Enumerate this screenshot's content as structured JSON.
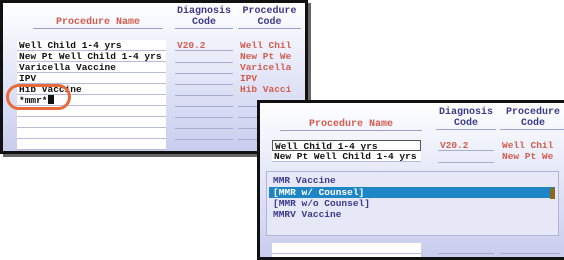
{
  "left_panel": {
    "headers": {
      "procedure_name": "Procedure Name",
      "diagnosis_code": [
        "Diagnosis",
        "Code"
      ],
      "procedure_code": [
        "Procedure",
        "Code"
      ]
    },
    "rows": [
      {
        "name": "Well Child 1-4 yrs",
        "diagnosis": "V20.2",
        "code": "Well Chil"
      },
      {
        "name": "New Pt Well Child 1-4 yrs",
        "diagnosis": "",
        "code": "New Pt We"
      },
      {
        "name": "Varicella Vaccine",
        "diagnosis": "",
        "code": "Varicella"
      },
      {
        "name": "IPV",
        "diagnosis": "",
        "code": "IPV"
      },
      {
        "name": "Hib Vaccine",
        "diagnosis": "",
        "code": "Hib Vacci"
      },
      {
        "name": "*mmr*",
        "diagnosis": "",
        "code": ""
      }
    ]
  },
  "right_panel": {
    "headers": {
      "procedure_name": "Procedure Name",
      "diagnosis_code": [
        "Diagnosis",
        "Code"
      ],
      "procedure_code": [
        "Procedure",
        "Code"
      ]
    },
    "rows": [
      {
        "name": "Well Child 1-4 yrs",
        "diagnosis": "V20.2",
        "code": "Well Chil"
      },
      {
        "name": "New Pt Well Child 1-4 yrs",
        "diagnosis": "",
        "code": "New Pt We"
      }
    ],
    "list_items": [
      "MMR Vaccine",
      "[MMR w/ Counsel]",
      "[MMR w/o Counsel]",
      "MMRV Vaccine"
    ],
    "selected_index": 1
  },
  "colors": {
    "accent_orange": "#e8693a",
    "selection_blue": "#1f86c6",
    "code_red": "#d35c4f",
    "label_navy": "#3b3a8a"
  }
}
